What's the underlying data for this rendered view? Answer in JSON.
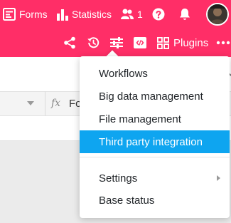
{
  "header": {
    "forms_label": "Forms",
    "statistics_label": "Statistics",
    "collaborators_count": "1",
    "plugins_label": "Plugins",
    "more_label": "•••"
  },
  "table": {
    "formula_icon": "fx",
    "formula_column_label": "Fo"
  },
  "menu": {
    "items": [
      {
        "label": "Workflows"
      },
      {
        "label": "Big data management"
      },
      {
        "label": "File management"
      },
      {
        "label": "Third party integration",
        "highlighted": true
      },
      {
        "label": "Settings",
        "has_submenu": true
      },
      {
        "label": "Base status"
      }
    ]
  },
  "colors": {
    "header": "#ff2e67",
    "highlight": "#0ea5f0",
    "menu_text": "#212529"
  },
  "icons": [
    "form-icon",
    "statistics-icon",
    "users-icon",
    "help-icon",
    "bell-icon",
    "share-icon",
    "history-icon",
    "filter-icon",
    "code-icon",
    "plugins-icon",
    "more-icon",
    "search-icon",
    "chevron-down-icon",
    "submenu-arrow-icon"
  ]
}
